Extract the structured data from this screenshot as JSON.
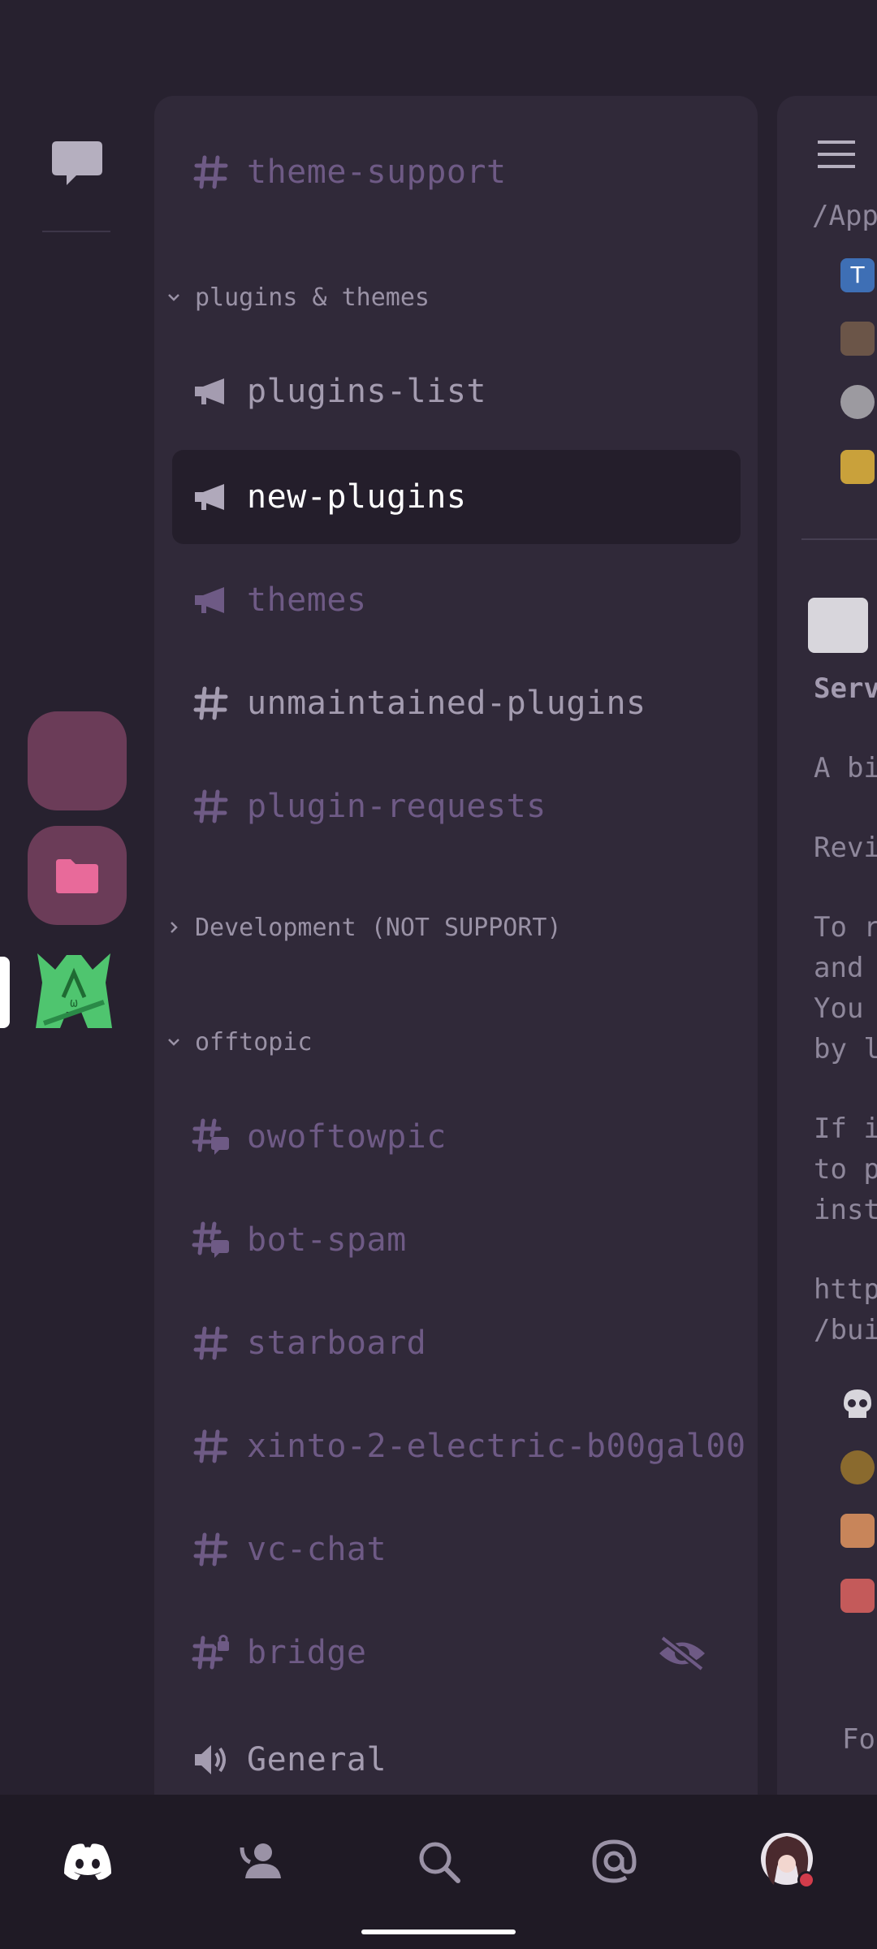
{
  "channels": {
    "top": "theme-support",
    "categories": [
      {
        "label": "plugins & themes"
      },
      {
        "label": "Development (NOT SUPPORT)"
      },
      {
        "label": "offtopic"
      }
    ],
    "plugins": [
      {
        "name": "plugins-list",
        "icon": "megaphone-icon"
      },
      {
        "name": "new-plugins",
        "icon": "megaphone-icon",
        "selected": true
      },
      {
        "name": "themes",
        "icon": "megaphone-icon"
      },
      {
        "name": "unmaintained-plugins",
        "icon": "hash-icon"
      },
      {
        "name": "plugin-requests",
        "icon": "hash-icon"
      }
    ],
    "offtopic": [
      {
        "name": "owoftowpic",
        "icon": "hash-thread-icon"
      },
      {
        "name": "bot-spam",
        "icon": "hash-thread-icon"
      },
      {
        "name": "starboard",
        "icon": "hash-icon"
      },
      {
        "name": "xinto-2-electric-b00gal00",
        "icon": "hash-icon"
      },
      {
        "name": "vc-chat",
        "icon": "hash-icon"
      },
      {
        "name": "bridge",
        "icon": "hash-lock-icon",
        "hidden": true
      },
      {
        "name": "General",
        "icon": "speaker-icon"
      }
    ]
  },
  "right_panel": {
    "lines": [
      "/Appe",
      "Serve",
      "A bit",
      "Revie",
      "To re",
      "and c",
      "You c",
      "by lo",
      "If it",
      "to pl",
      "instr",
      "https",
      "/buil",
      "Fo"
    ]
  },
  "tabs": [
    "home-icon",
    "friends-icon",
    "search-icon",
    "mentions-icon",
    "profile-avatar"
  ],
  "colors": {
    "background": "#27212f",
    "panel": "#302939",
    "selected": "#241e2b",
    "muted_channel": "#6e5a85",
    "folder": "#6b3c58",
    "folder_accent": "#e86a9a",
    "status_dnd": "#d23c4b"
  }
}
